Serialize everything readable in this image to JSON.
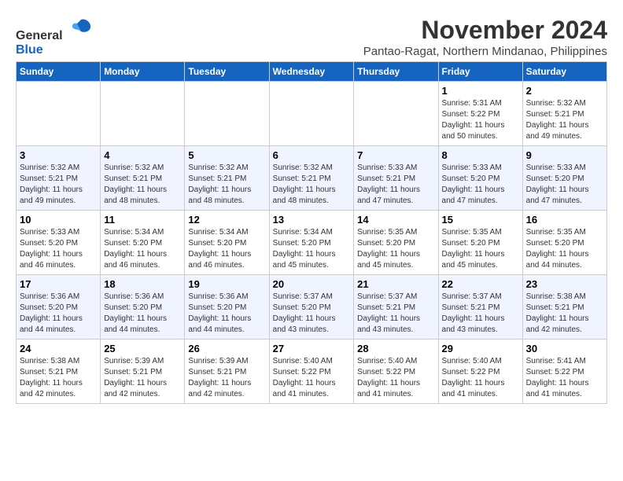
{
  "header": {
    "logo_line1": "General",
    "logo_line2": "Blue",
    "month_title": "November 2024",
    "subtitle": "Pantao-Ragat, Northern Mindanao, Philippines"
  },
  "weekdays": [
    "Sunday",
    "Monday",
    "Tuesday",
    "Wednesday",
    "Thursday",
    "Friday",
    "Saturday"
  ],
  "weeks": [
    [
      {
        "day": "",
        "info": ""
      },
      {
        "day": "",
        "info": ""
      },
      {
        "day": "",
        "info": ""
      },
      {
        "day": "",
        "info": ""
      },
      {
        "day": "",
        "info": ""
      },
      {
        "day": "1",
        "info": "Sunrise: 5:31 AM\nSunset: 5:22 PM\nDaylight: 11 hours\nand 50 minutes."
      },
      {
        "day": "2",
        "info": "Sunrise: 5:32 AM\nSunset: 5:21 PM\nDaylight: 11 hours\nand 49 minutes."
      }
    ],
    [
      {
        "day": "3",
        "info": "Sunrise: 5:32 AM\nSunset: 5:21 PM\nDaylight: 11 hours\nand 49 minutes."
      },
      {
        "day": "4",
        "info": "Sunrise: 5:32 AM\nSunset: 5:21 PM\nDaylight: 11 hours\nand 48 minutes."
      },
      {
        "day": "5",
        "info": "Sunrise: 5:32 AM\nSunset: 5:21 PM\nDaylight: 11 hours\nand 48 minutes."
      },
      {
        "day": "6",
        "info": "Sunrise: 5:32 AM\nSunset: 5:21 PM\nDaylight: 11 hours\nand 48 minutes."
      },
      {
        "day": "7",
        "info": "Sunrise: 5:33 AM\nSunset: 5:21 PM\nDaylight: 11 hours\nand 47 minutes."
      },
      {
        "day": "8",
        "info": "Sunrise: 5:33 AM\nSunset: 5:20 PM\nDaylight: 11 hours\nand 47 minutes."
      },
      {
        "day": "9",
        "info": "Sunrise: 5:33 AM\nSunset: 5:20 PM\nDaylight: 11 hours\nand 47 minutes."
      }
    ],
    [
      {
        "day": "10",
        "info": "Sunrise: 5:33 AM\nSunset: 5:20 PM\nDaylight: 11 hours\nand 46 minutes."
      },
      {
        "day": "11",
        "info": "Sunrise: 5:34 AM\nSunset: 5:20 PM\nDaylight: 11 hours\nand 46 minutes."
      },
      {
        "day": "12",
        "info": "Sunrise: 5:34 AM\nSunset: 5:20 PM\nDaylight: 11 hours\nand 46 minutes."
      },
      {
        "day": "13",
        "info": "Sunrise: 5:34 AM\nSunset: 5:20 PM\nDaylight: 11 hours\nand 45 minutes."
      },
      {
        "day": "14",
        "info": "Sunrise: 5:35 AM\nSunset: 5:20 PM\nDaylight: 11 hours\nand 45 minutes."
      },
      {
        "day": "15",
        "info": "Sunrise: 5:35 AM\nSunset: 5:20 PM\nDaylight: 11 hours\nand 45 minutes."
      },
      {
        "day": "16",
        "info": "Sunrise: 5:35 AM\nSunset: 5:20 PM\nDaylight: 11 hours\nand 44 minutes."
      }
    ],
    [
      {
        "day": "17",
        "info": "Sunrise: 5:36 AM\nSunset: 5:20 PM\nDaylight: 11 hours\nand 44 minutes."
      },
      {
        "day": "18",
        "info": "Sunrise: 5:36 AM\nSunset: 5:20 PM\nDaylight: 11 hours\nand 44 minutes."
      },
      {
        "day": "19",
        "info": "Sunrise: 5:36 AM\nSunset: 5:20 PM\nDaylight: 11 hours\nand 44 minutes."
      },
      {
        "day": "20",
        "info": "Sunrise: 5:37 AM\nSunset: 5:20 PM\nDaylight: 11 hours\nand 43 minutes."
      },
      {
        "day": "21",
        "info": "Sunrise: 5:37 AM\nSunset: 5:21 PM\nDaylight: 11 hours\nand 43 minutes."
      },
      {
        "day": "22",
        "info": "Sunrise: 5:37 AM\nSunset: 5:21 PM\nDaylight: 11 hours\nand 43 minutes."
      },
      {
        "day": "23",
        "info": "Sunrise: 5:38 AM\nSunset: 5:21 PM\nDaylight: 11 hours\nand 42 minutes."
      }
    ],
    [
      {
        "day": "24",
        "info": "Sunrise: 5:38 AM\nSunset: 5:21 PM\nDaylight: 11 hours\nand 42 minutes."
      },
      {
        "day": "25",
        "info": "Sunrise: 5:39 AM\nSunset: 5:21 PM\nDaylight: 11 hours\nand 42 minutes."
      },
      {
        "day": "26",
        "info": "Sunrise: 5:39 AM\nSunset: 5:21 PM\nDaylight: 11 hours\nand 42 minutes."
      },
      {
        "day": "27",
        "info": "Sunrise: 5:40 AM\nSunset: 5:22 PM\nDaylight: 11 hours\nand 41 minutes."
      },
      {
        "day": "28",
        "info": "Sunrise: 5:40 AM\nSunset: 5:22 PM\nDaylight: 11 hours\nand 41 minutes."
      },
      {
        "day": "29",
        "info": "Sunrise: 5:40 AM\nSunset: 5:22 PM\nDaylight: 11 hours\nand 41 minutes."
      },
      {
        "day": "30",
        "info": "Sunrise: 5:41 AM\nSunset: 5:22 PM\nDaylight: 11 hours\nand 41 minutes."
      }
    ]
  ]
}
